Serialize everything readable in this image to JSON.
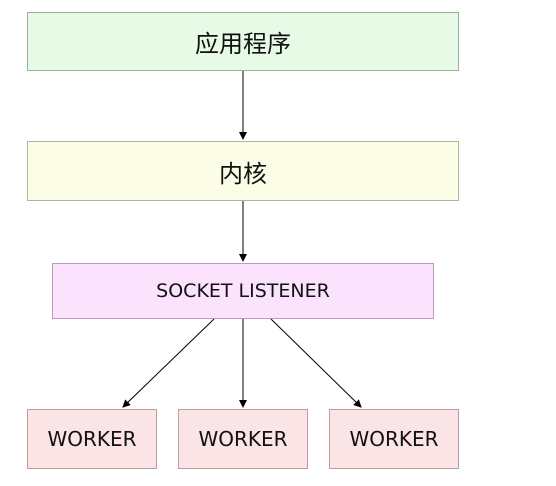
{
  "nodes": {
    "app": "应用程序",
    "kernel": "内核",
    "listener": "SOCKET LISTENER",
    "workers": [
      "WORKER",
      "WORKER",
      "WORKER"
    ]
  },
  "colors": {
    "app_fill": "#e6fae6",
    "kernel_fill": "#fcfde6",
    "listener_fill": "#fbe3fd",
    "worker_fill": "#fbe4e6",
    "edge": "#000000"
  },
  "edges": [
    {
      "from": "app",
      "to": "kernel"
    },
    {
      "from": "kernel",
      "to": "listener"
    },
    {
      "from": "listener",
      "to": "worker-1"
    },
    {
      "from": "listener",
      "to": "worker-2"
    },
    {
      "from": "listener",
      "to": "worker-3"
    }
  ]
}
